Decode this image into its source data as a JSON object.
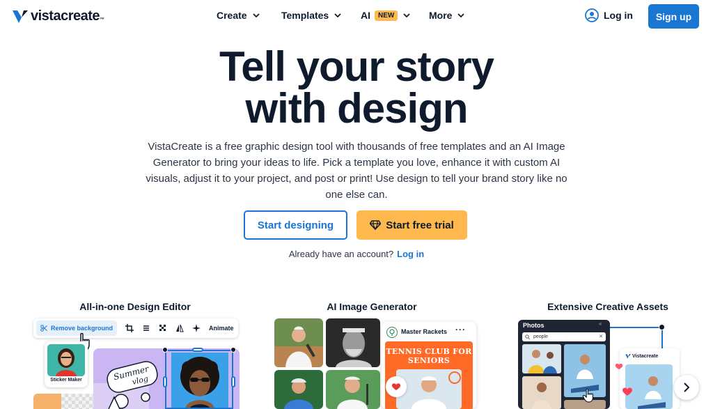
{
  "brand": {
    "name": "vistacreate",
    "trademark": "™",
    "accent": "#1976d2",
    "highlight": "#ffb84d"
  },
  "nav": {
    "items": [
      {
        "label": "Create"
      },
      {
        "label": "Templates"
      },
      {
        "label": "AI",
        "badge": "NEW"
      },
      {
        "label": "More"
      }
    ],
    "login_label": "Log in",
    "signup_label": "Sign up"
  },
  "hero": {
    "title_line1": "Tell your story",
    "title_line2": "with design",
    "subtitle": "VistaCreate is a free graphic design tool with thousands of free templates and an AI Image Generator to bring your ideas to life. Pick a template you love, enhance it with custom AI visuals, adjust it to your project, and post or print! Use design to tell your brand story like no one else can.",
    "primary_button": "Start designing",
    "secondary_button": "Start free trial",
    "account_prompt": "Already have an account?",
    "account_link": "Log in"
  },
  "features": [
    {
      "title": "All-in-one Design Editor",
      "toolbar": {
        "remove_bg": "Remove background",
        "animate": "Animate"
      },
      "sticker_label": "Sticker Maker"
    },
    {
      "title": "AI Image Generator",
      "post": {
        "account": "Master Rackets",
        "headline": "TENNIS CLUB FOR SENIORS"
      }
    },
    {
      "title": "Extensive Creative Assets",
      "panel": {
        "title": "Photos",
        "search_value": "people"
      },
      "brand_label": "Vistacreate"
    }
  ]
}
